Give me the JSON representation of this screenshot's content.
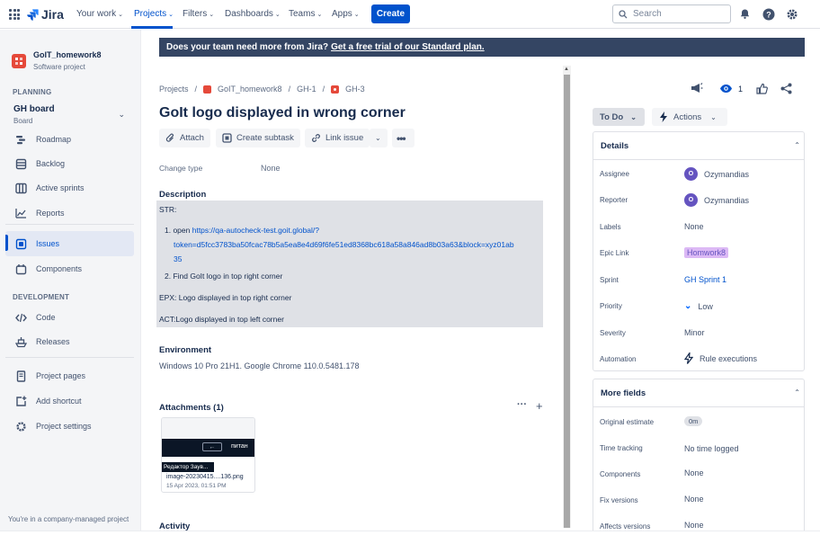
{
  "topnav": {
    "logo_text": "Jira",
    "items": [
      "Your work",
      "Projects",
      "Filters",
      "Dashboards",
      "Teams",
      "Apps"
    ],
    "create_label": "Create",
    "search_placeholder": "Search"
  },
  "sidebar": {
    "project_name": "GoIT_homework8",
    "project_type": "Software project",
    "planning_title": "PLANNING",
    "board_title": "GH board",
    "board_sub": "Board",
    "planning_items": [
      "Roadmap",
      "Backlog",
      "Active sprints",
      "Reports"
    ],
    "main_items": [
      "Issues",
      "Components"
    ],
    "development_title": "DEVELOPMENT",
    "development_items": [
      "Code",
      "Releases"
    ],
    "bottom_items": [
      "Project pages",
      "Add shortcut",
      "Project settings"
    ],
    "footer": "You're in a company-managed project"
  },
  "banner": {
    "text": "Does your team need more from Jira?",
    "link": "Get a free trial of our Standard plan."
  },
  "breadcrumb": [
    "Projects",
    "GoIT_homework8",
    "GH-1",
    "GH-3"
  ],
  "issue": {
    "title": "GoIt logo displayed in wrong corner",
    "actions": [
      "Attach",
      "Create subtask",
      "Link issue"
    ],
    "change_type_label": "Change type",
    "change_type_value": "None",
    "description_title": "Description",
    "description": {
      "str": "STR:",
      "step1_prefix": "1.  open ",
      "step1_link_a": "https://qa-autocheck-test.goit.global/?",
      "step1_link_b": "token=d5fcc3783ba50fcac78b5a5ea8e4d69f6fe51ed8368bc618a58a846ad8b03a63&block=xyz01ab",
      "step1_link_c": "35",
      "step2": "2.  Find GoIt logo in top right corner",
      "epx": "EPX: Logo displayed in top right corner",
      "act": "ACT:Logo displayed in top left corner"
    },
    "environment_title": "Environment",
    "environment": "Windows 10 Pro 21H1. Google Chrome 110.0.5481.178",
    "attachments_title": "Attachments (1)",
    "attachment": {
      "thumb_btn": "←",
      "thumb_text": "питан",
      "thumb_tag": "Редактор Заув...",
      "name": "image-20230415....136.png",
      "date": "15 Apr 2023, 01:51 PM"
    },
    "activity_title": "Activity"
  },
  "right": {
    "watch_count": "1",
    "status": "To Do",
    "actions": "Actions",
    "details_title": "Details",
    "details": [
      {
        "label": "Assignee",
        "value": "Ozymandias"
      },
      {
        "label": "Reporter",
        "value": "Ozymandias"
      },
      {
        "label": "Labels",
        "value": "None"
      },
      {
        "label": "Epic Link",
        "value": "Homwork8"
      },
      {
        "label": "Sprint",
        "value": "GH Sprint 1"
      },
      {
        "label": "Priority",
        "value": "Low"
      },
      {
        "label": "Severity",
        "value": "Minor"
      },
      {
        "label": "Automation",
        "value": "Rule executions"
      }
    ],
    "avatar_letter": "O",
    "more_title": "More fields",
    "more": [
      {
        "label": "Original estimate",
        "value": "0m"
      },
      {
        "label": "Time tracking",
        "value": "No time logged"
      },
      {
        "label": "Components",
        "value": "None"
      },
      {
        "label": "Fix versions",
        "value": "None"
      },
      {
        "label": "Affects versions",
        "value": "None"
      }
    ]
  },
  "colors": {
    "brand": "#0052cc",
    "banner": "#344563",
    "project_avatar": "#e5493a",
    "avatar": "#6554c0"
  }
}
